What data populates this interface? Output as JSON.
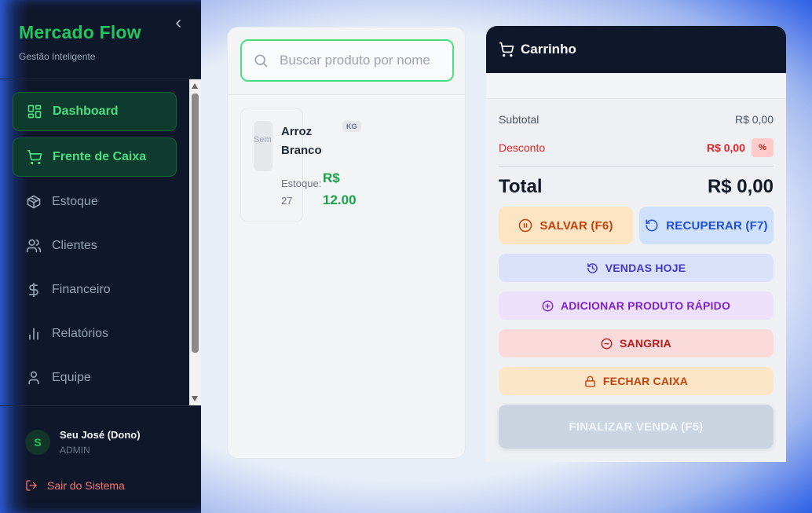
{
  "brand": {
    "title": "Mercado Flow",
    "subtitle": "Gestão Inteligente"
  },
  "sidebar": {
    "items": [
      {
        "label": "Dashboard",
        "icon": "dashboard-icon",
        "active": true
      },
      {
        "label": "Frente de Caixa",
        "icon": "cart-icon",
        "active": true
      },
      {
        "label": "Estoque",
        "icon": "box-icon",
        "active": false
      },
      {
        "label": "Clientes",
        "icon": "users-icon",
        "active": false
      },
      {
        "label": "Financeiro",
        "icon": "dollar-icon",
        "active": false
      },
      {
        "label": "Relatórios",
        "icon": "chart-icon",
        "active": false
      },
      {
        "label": "Equipe",
        "icon": "user-icon",
        "active": false
      }
    ]
  },
  "user": {
    "initial": "S",
    "name": "Seu José (Dono)",
    "role": "ADMIN"
  },
  "logout_label": "Sair do Sistema",
  "search": {
    "placeholder": "Buscar produto por nome"
  },
  "products": [
    {
      "thumb_text": "Sem foto",
      "name": "Arroz Branco",
      "unit": "KG",
      "stock_label": "Estoque:",
      "stock": "27",
      "price": "R$ 12.00"
    }
  ],
  "cart": {
    "title": "Carrinho",
    "subtotal_label": "Subtotal",
    "subtotal_value": "R$ 0,00",
    "discount_label": "Desconto",
    "discount_value": "R$ 0,00",
    "discount_button": "%",
    "total_label": "Total",
    "total_value": "R$ 0,00",
    "save_label": "SALVAR (F6)",
    "recover_label": "RECUPERAR (F7)",
    "today_label": "VENDAS HOJE",
    "quick_add_label": "ADICIONAR PRODUTO RÁPIDO",
    "sangria_label": "SANGRIA",
    "close_register_label": "FECHAR CAIXA",
    "finalize_label": "FINALIZAR VENDA (F5)"
  },
  "colors": {
    "brand_green": "#22c55e",
    "sidebar_bg": "#0f172a",
    "accent_blue_glow": "#2f64e8",
    "discount_red": "#dc2626",
    "price_green": "#16a34a"
  }
}
